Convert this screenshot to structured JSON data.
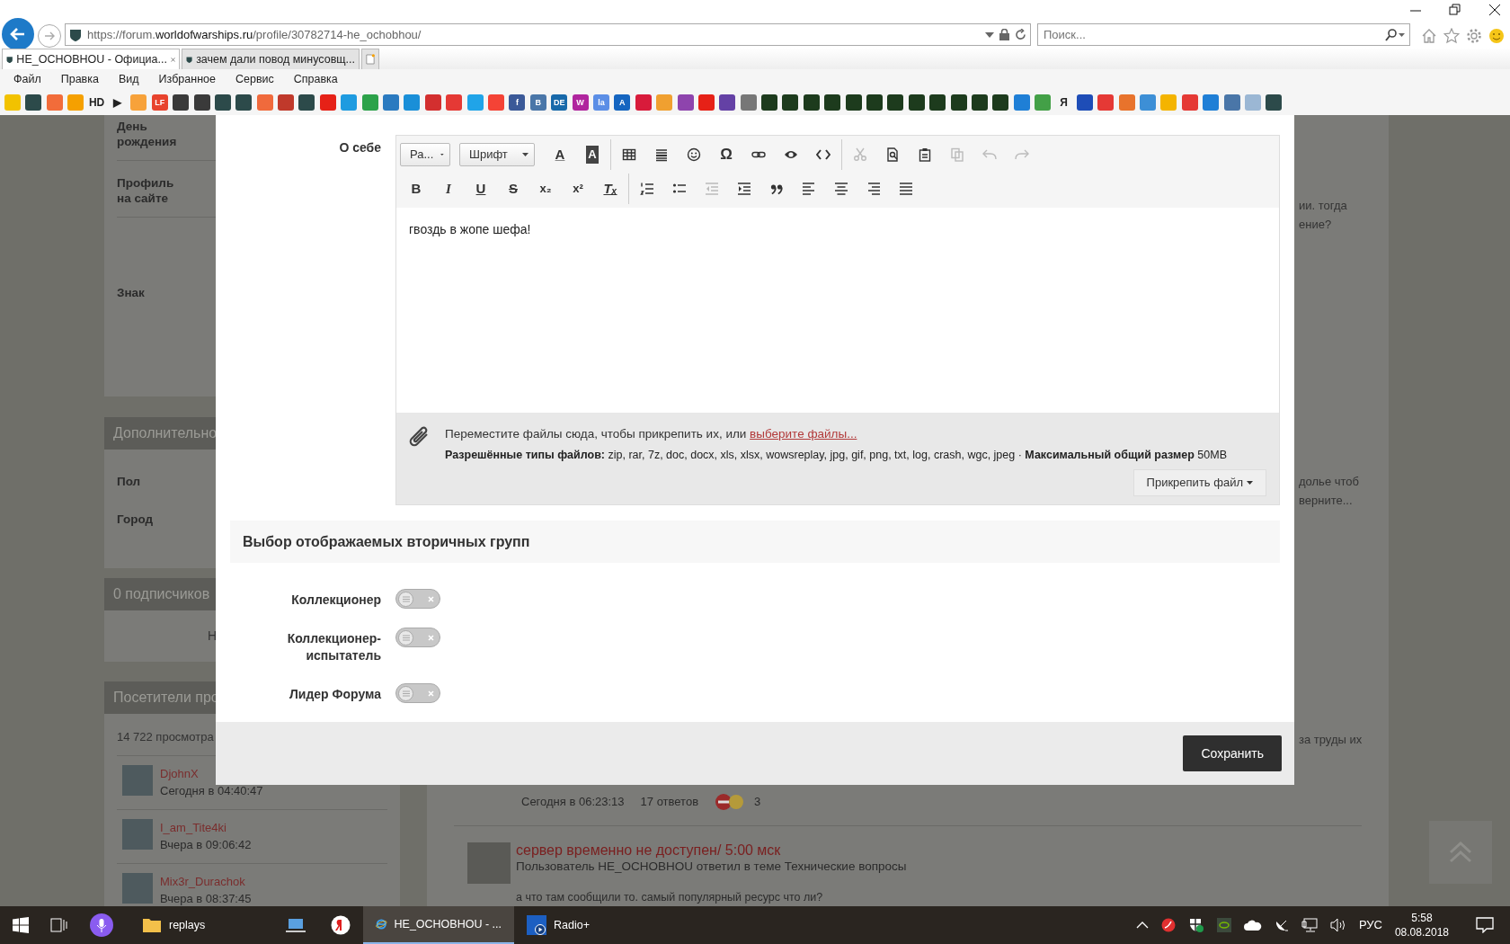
{
  "address_bar": {
    "url_parts": [
      {
        "text": "https://forum.",
        "strong": false
      },
      {
        "text": "worldofwarships.ru",
        "strong": true
      },
      {
        "text": "/profile/30782714-he_ochobhou/",
        "strong": false
      }
    ]
  },
  "search": {
    "placeholder": "Поиск..."
  },
  "tabs": [
    {
      "label": "HE_OCHOBHOU - Официа...",
      "selected": true
    },
    {
      "label": "зачем дали повод минусовщ...",
      "selected": false
    }
  ],
  "menu": [
    "Файл",
    "Правка",
    "Вид",
    "Избранное",
    "Сервис",
    "Справка"
  ],
  "favorites": [
    {
      "kind": "icon",
      "color": "#f2c200"
    },
    {
      "kind": "icon",
      "color": "#2c4a4a"
    },
    {
      "kind": "icon",
      "color": "#f26c3a"
    },
    {
      "kind": "icon",
      "color": "#f5a000"
    },
    {
      "kind": "text",
      "label": "HD"
    },
    {
      "kind": "text",
      "label": "▶"
    },
    {
      "kind": "icon",
      "color": "#f7a23a"
    },
    {
      "kind": "glyph",
      "label": "LF",
      "color": "#e8432d"
    },
    {
      "kind": "icon",
      "color": "#3a3a3a"
    },
    {
      "kind": "icon",
      "color": "#3a3a3a"
    },
    {
      "kind": "icon",
      "color": "#2c4a4a"
    },
    {
      "kind": "icon",
      "color": "#2c4a4a"
    },
    {
      "kind": "icon",
      "color": "#f06a3c"
    },
    {
      "kind": "icon",
      "color": "#c0392b"
    },
    {
      "kind": "icon",
      "color": "#2c4a4a"
    },
    {
      "kind": "icon",
      "color": "#e62117"
    },
    {
      "kind": "icon",
      "color": "#1e9be0"
    },
    {
      "kind": "icon",
      "color": "#2ca24a"
    },
    {
      "kind": "icon",
      "color": "#2a7ac0"
    },
    {
      "kind": "icon",
      "color": "#1a8fd8"
    },
    {
      "kind": "icon",
      "color": "#d32f2f"
    },
    {
      "kind": "icon",
      "color": "#e53935"
    },
    {
      "kind": "icon",
      "color": "#20a4e8"
    },
    {
      "kind": "icon",
      "color": "#f44336"
    },
    {
      "kind": "glyph",
      "label": "f",
      "color": "#3b5998"
    },
    {
      "kind": "glyph",
      "label": "B",
      "color": "#4a76a8"
    },
    {
      "kind": "glyph",
      "label": "DE",
      "color": "#1769aa"
    },
    {
      "kind": "glyph",
      "label": "W",
      "color": "#b0259e"
    },
    {
      "kind": "glyph",
      "label": "la",
      "color": "#5b8ee6"
    },
    {
      "kind": "glyph",
      "label": "A",
      "color": "#1565c0"
    },
    {
      "kind": "icon",
      "color": "#d81b3b"
    },
    {
      "kind": "icon",
      "color": "#f0a030"
    },
    {
      "kind": "icon",
      "color": "#8e44ad"
    },
    {
      "kind": "icon",
      "color": "#e62117"
    },
    {
      "kind": "icon",
      "color": "#6441a5"
    },
    {
      "kind": "icon",
      "color": "#777777"
    },
    {
      "kind": "icon",
      "color": "#1d3b1d"
    },
    {
      "kind": "icon",
      "color": "#1d3b1d"
    },
    {
      "kind": "icon",
      "color": "#1d3b1d"
    },
    {
      "kind": "icon",
      "color": "#1d3b1d"
    },
    {
      "kind": "icon",
      "color": "#1d3b1d"
    },
    {
      "kind": "icon",
      "color": "#1d3b1d"
    },
    {
      "kind": "icon",
      "color": "#1d3b1d"
    },
    {
      "kind": "icon",
      "color": "#1d3b1d"
    },
    {
      "kind": "icon",
      "color": "#1d3b1d"
    },
    {
      "kind": "icon",
      "color": "#1d3b1d"
    },
    {
      "kind": "icon",
      "color": "#1d3b1d"
    },
    {
      "kind": "icon",
      "color": "#1d3b1d"
    },
    {
      "kind": "icon",
      "color": "#1f7fd6"
    },
    {
      "kind": "icon",
      "color": "#43a047"
    },
    {
      "kind": "text",
      "label": "Я"
    },
    {
      "kind": "icon",
      "color": "#1e4db7"
    },
    {
      "kind": "icon",
      "color": "#e53935"
    },
    {
      "kind": "icon",
      "color": "#e8732c"
    },
    {
      "kind": "icon",
      "color": "#3d8fd6"
    },
    {
      "kind": "icon",
      "color": "#f4b400"
    },
    {
      "kind": "icon",
      "color": "#e53935"
    },
    {
      "kind": "icon",
      "color": "#1f7fd6"
    },
    {
      "kind": "icon",
      "color": "#4a76a8"
    },
    {
      "kind": "icon",
      "color": "#9bb7d4"
    },
    {
      "kind": "icon",
      "color": "#2c4a4a"
    }
  ],
  "background_page": {
    "left_fields": [
      "День рождения",
      "Профиль на сайте",
      "Знак"
    ],
    "extra_panel": {
      "title": "Дополнительно",
      "fields": [
        "Пол",
        "Город"
      ]
    },
    "followers_panel": {
      "title": "0 подписчиков",
      "body": "Н"
    },
    "visitors_panel": {
      "title": "Посетители про",
      "count": "14 722 просмотра",
      "visitors": [
        {
          "name": "DjohnX",
          "time": "Сегодня в 04:40:47"
        },
        {
          "name": "I_am_Tite4ki",
          "time": "Вчера в 09:06:42"
        },
        {
          "name": "Mix3r_Durachok",
          "time": "Вчера в 08:37:45"
        }
      ]
    },
    "right_fragments": [
      [
        "ии. тогда",
        "ение?"
      ],
      [
        "долье чтоб",
        "верните..."
      ],
      [
        "за труды их"
      ]
    ],
    "topic_meta": {
      "date": "Сегодня в 06:23:13",
      "replies": "17 ответов",
      "reactions": "3"
    },
    "activity": {
      "title": "сервер временно не доступен/ 5:00 мск",
      "subtitle": "Пользователь HE_OCHOBHOU ответил в теме Технические вопросы",
      "excerpt": "а что там сообщили то. самый популярный ресурс что ли?"
    }
  },
  "modal": {
    "about_label": "О себе",
    "toolbar": [
      [
        {
          "kind": "format",
          "label": "Ра..."
        },
        {
          "kind": "font",
          "label": "Шрифт"
        },
        {
          "kind": "textcolor",
          "glyph": "A",
          "disabled": false
        },
        {
          "kind": "bgcolor",
          "glyph": "A",
          "disabled": false
        },
        {
          "kind": "sep"
        },
        {
          "kind": "table",
          "disabled": false
        },
        {
          "kind": "hr",
          "disabled": false
        },
        {
          "kind": "smiley",
          "disabled": false
        },
        {
          "kind": "omega",
          "glyph": "Ω",
          "disabled": false
        },
        {
          "kind": "link",
          "disabled": false
        },
        {
          "kind": "eye",
          "disabled": false
        },
        {
          "kind": "code",
          "disabled": false
        },
        {
          "kind": "sep"
        },
        {
          "kind": "cut",
          "disabled": true
        },
        {
          "kind": "pastepreview",
          "disabled": false
        },
        {
          "kind": "paste",
          "disabled": false
        },
        {
          "kind": "copy",
          "disabled": true
        },
        {
          "kind": "undo",
          "disabled": true
        },
        {
          "kind": "redo",
          "disabled": true
        }
      ],
      [
        {
          "kind": "bold",
          "glyph": "B",
          "disabled": false
        },
        {
          "kind": "italic",
          "glyph": "I",
          "disabled": false
        },
        {
          "kind": "underline",
          "glyph": "U",
          "disabled": false
        },
        {
          "kind": "strike",
          "glyph": "S",
          "disabled": false
        },
        {
          "kind": "sub",
          "glyph": "x₂",
          "disabled": false
        },
        {
          "kind": "sup",
          "glyph": "x²",
          "disabled": false
        },
        {
          "kind": "clear",
          "glyph": "Tₓ",
          "disabled": false
        },
        {
          "kind": "sep"
        },
        {
          "kind": "ol",
          "disabled": false
        },
        {
          "kind": "ul",
          "disabled": false
        },
        {
          "kind": "outdent",
          "disabled": true
        },
        {
          "kind": "indent",
          "disabled": false
        },
        {
          "kind": "quote",
          "disabled": false
        },
        {
          "kind": "left",
          "disabled": false
        },
        {
          "kind": "center",
          "disabled": false
        },
        {
          "kind": "right",
          "disabled": false
        },
        {
          "kind": "justify",
          "disabled": false
        }
      ]
    ],
    "about_text": "гвоздь в жопе шефа!",
    "attach": {
      "hint": "Переместите файлы сюда, чтобы прикрепить их, или ",
      "link": "выберите файлы...",
      "allowed": "**Разрешённые типы файлов:** zip, rar, 7z, doc, docx, xls, xlsx, wowsreplay, jpg, gif, png, txt, log, crash, wgc, jpeg · **Максимальный общий размер** 50MB",
      "button": "Прикрепить файл"
    },
    "groups_title": "Выбор отображаемых вторичных групп",
    "groups": [
      {
        "label": "Коллекционер",
        "on": false
      },
      {
        "label": "Коллекционер-испытатель",
        "on": false
      },
      {
        "label": "Лидер Форума",
        "on": false
      }
    ],
    "save": "Сохранить"
  },
  "taskbar": {
    "apps": [
      {
        "kind": "folder",
        "label": "replays",
        "active": false
      },
      {
        "kind": "laptop",
        "active": false
      },
      {
        "kind": "yandex",
        "active": false
      },
      {
        "kind": "ie",
        "label": "HE_OCHOBHOU - ...",
        "active": true
      },
      {
        "kind": "radio",
        "label": "Radio+",
        "active": false
      }
    ],
    "language": "РУС",
    "time": "5:58",
    "date": "08.08.2018"
  }
}
